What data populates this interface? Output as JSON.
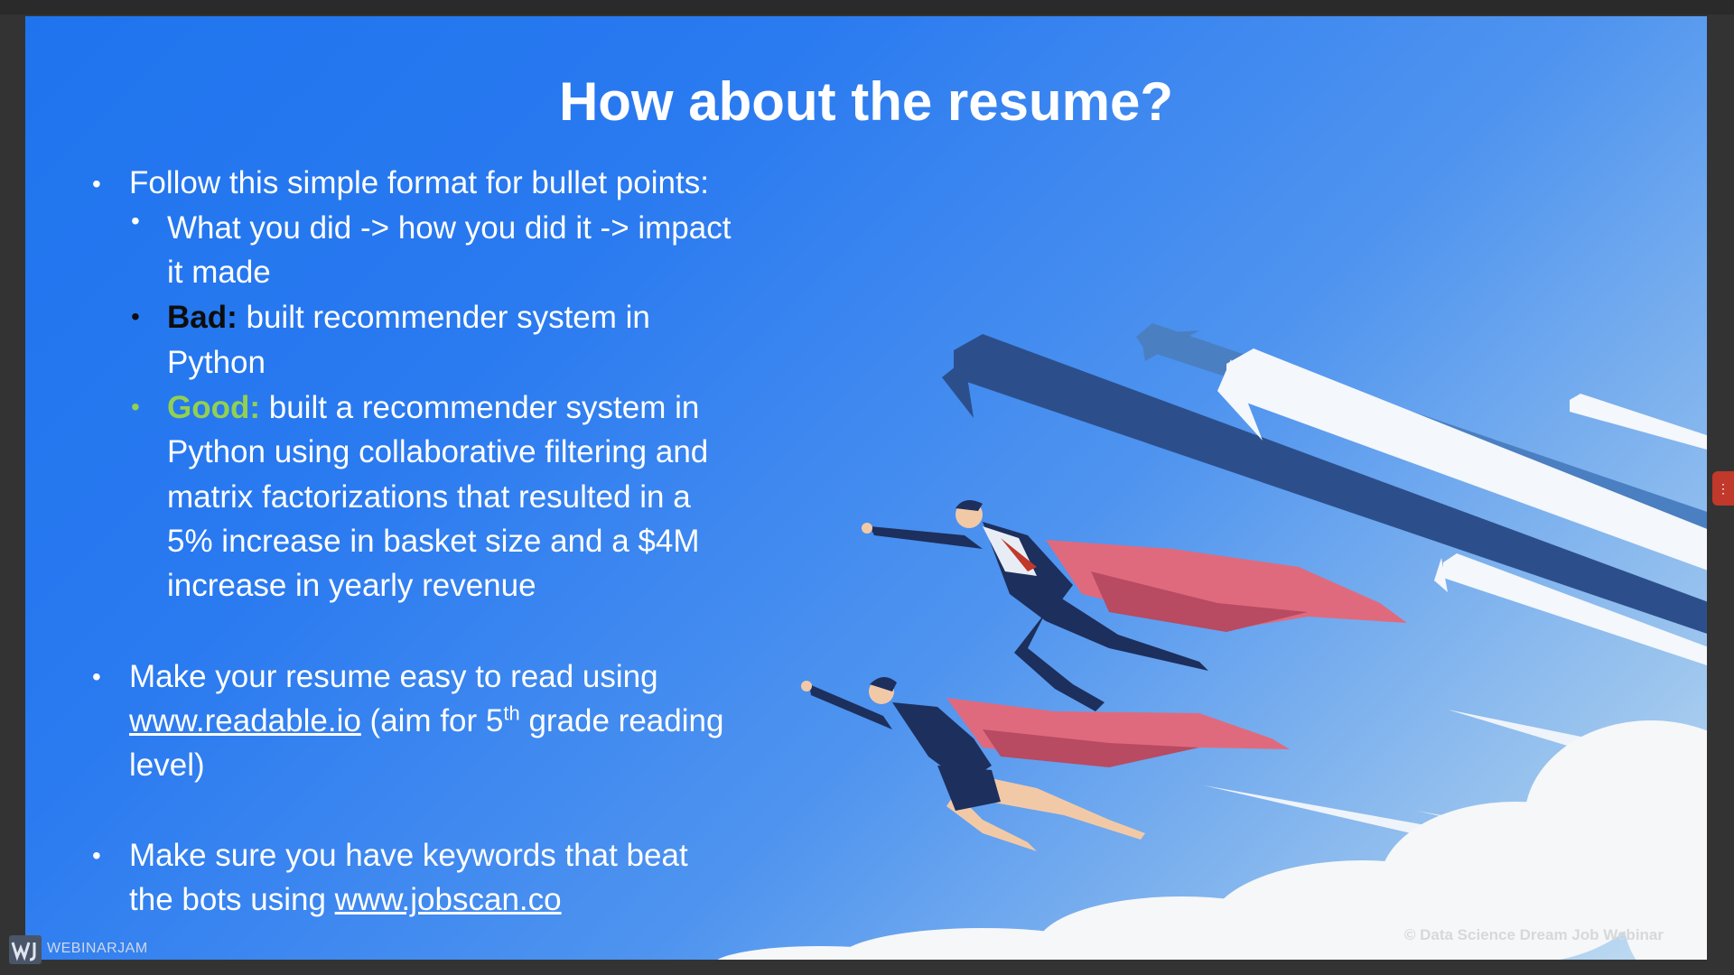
{
  "slide": {
    "title": "How about the resume?",
    "bullet_glyph": "•",
    "lines": {
      "b1": "Follow this simple format for bullet points:",
      "s1a": "What you did -> how you did it -> impact",
      "s1b": "it made",
      "bad_label": "Bad:",
      "s2a": " built recommender system in",
      "s2b": "Python",
      "good_label": "Good:",
      "s3a": " built a recommender system in",
      "s3b": "Python using collaborative filtering and",
      "s3c": "matrix factorizations that resulted in a",
      "s3d": "5% increase in basket size and a $4M",
      "s3e": "increase in yearly revenue",
      "b2a": "Make your resume easy to read using",
      "b2_link": "www.readable.io",
      "b2_mid": " (aim for 5",
      "b2_sup": "th",
      "b2_end": " grade reading",
      "b2c": "level)",
      "b3a": "Make sure you have keywords that beat",
      "b3_pre": "the bots using ",
      "b3_link": "www.jobscan.co"
    },
    "copyright": "© Data Science Dream Job Webinar"
  },
  "app": {
    "brand": "WEBINARJAM",
    "side_tab_glyph": "⋮"
  },
  "colors": {
    "slide_blue": "#2a7af0",
    "bad": "#0d0d0d",
    "good": "#92d050",
    "cape": "#e06a7d",
    "arrow_navy": "#2c4f8c"
  }
}
